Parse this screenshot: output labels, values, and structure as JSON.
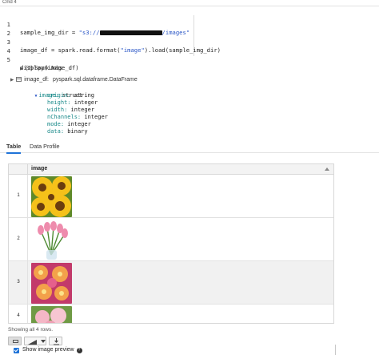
{
  "cell": {
    "label": "Cmd 4"
  },
  "code": {
    "lines": [
      {
        "num": "1",
        "pre": "sample_img_dir = ",
        "str_open": "\"s3://",
        "str_close": "/images\""
      },
      {
        "num": "2",
        "text": ""
      },
      {
        "num": "3",
        "pre": "image_df = spark.read.format(",
        "str": "\"image\"",
        "post": ").load(sample_img_dir)"
      },
      {
        "num": "4",
        "text": ""
      },
      {
        "num": "5",
        "text": "display(image_df)"
      }
    ]
  },
  "output": {
    "spark_jobs": "(2) Spark Jobs",
    "df_name": "image_df:",
    "df_type": "pyspark.sql.dataframe.DataFrame",
    "schema": {
      "root_key": "image:",
      "root_type": "struct",
      "fields": [
        {
          "key": "origin:",
          "type": "string"
        },
        {
          "key": "height:",
          "type": "integer"
        },
        {
          "key": "width:",
          "type": "integer"
        },
        {
          "key": "nChannels:",
          "type": "integer"
        },
        {
          "key": "mode:",
          "type": "integer"
        },
        {
          "key": "data:",
          "type": "binary"
        }
      ]
    }
  },
  "tabs": [
    {
      "label": "Table",
      "active": true
    },
    {
      "label": "Data Profile",
      "active": false
    }
  ],
  "table": {
    "column": "image",
    "rows": [
      {
        "index": "1",
        "image": "sunflowers-image"
      },
      {
        "index": "2",
        "image": "pink-tulips-image"
      },
      {
        "index": "3",
        "image": "plumeria-flowers-image"
      },
      {
        "index": "4",
        "image": "roses-image"
      }
    ]
  },
  "footer": {
    "status": "Showing all 4 rows.",
    "show_preview_label": "Show image preview",
    "show_preview_checked": true
  },
  "colors": {
    "accent": "#1f73d8",
    "string": "#2a56c6",
    "schema_key": "#1a8a8a"
  }
}
